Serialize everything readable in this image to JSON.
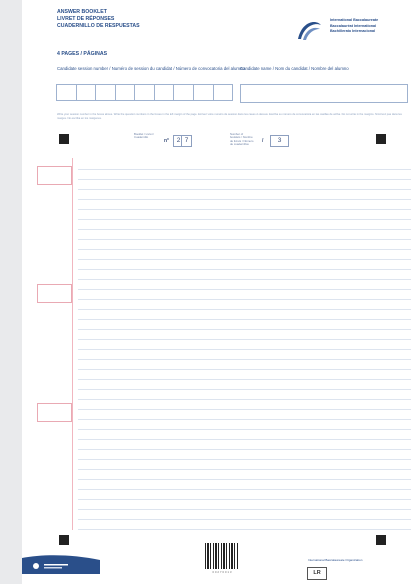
{
  "header": {
    "title_en": "ANSWER BOOKLET",
    "title_fr": "LIVRET DE RÉPONSES",
    "title_es": "CUADERNILLO DE RESPUESTAS",
    "pages": "4 PAGES / PÁGINAS"
  },
  "org": {
    "line1": "International Baccalaureate",
    "line2": "Baccalauréat International",
    "line3": "Bachillerato Internacional"
  },
  "candidate": {
    "number_label": "Candidate session number / Numéro de session du candidat / Número de convocatoria del alumno",
    "name_label": "Candidate name / Nom du candidat / Nombre del alumno"
  },
  "instructions": "Write your session number in the boxes above. Write the question numbers in the boxes in the left margin of the page. Écrivez votre numéro de session dans les cases ci-dessus. Escriba su número de convocatoria en las casillas de arriba. Do not write in the margins. N'écrivez pas dans les marges. No escriba en los márgenes.",
  "binding": {
    "booklet_label": "Booklet / Livret / Cuadernillo",
    "booklet_prefix": "n°",
    "booklet_digits": [
      "2",
      "7"
    ],
    "of_label": "Number of booklets / Nombre de livrets / Número de cuadernillos",
    "of_sep": "/",
    "of_digit": "3"
  },
  "footer": {
    "barcode_number": "0 0 2 7 0 0 1 3",
    "org": "International Baccalaureate Organization",
    "code": "LR"
  },
  "colors": {
    "brand_blue": "#2a4f8a",
    "margin_pink": "#f1b6bf",
    "rule_blue": "#dde4ef"
  }
}
